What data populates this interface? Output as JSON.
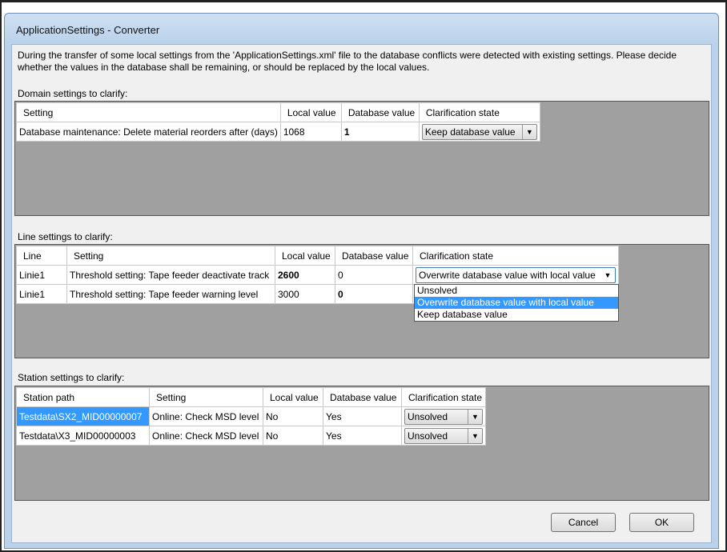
{
  "window": {
    "title": "ApplicationSettings - Converter"
  },
  "description": "During the transfer of some local settings from the 'ApplicationSettings.xml' file to the database conflicts were detected with existing settings. Please decide whether the values in the database shall be remaining, or should be replaced by the local values.",
  "domain": {
    "label": "Domain settings to clarify:",
    "headers": [
      "Setting",
      "Local value",
      "Database value",
      "Clarification state"
    ],
    "rows": [
      {
        "setting": "Database maintenance: Delete material reorders after (days)",
        "local": "1068",
        "database": "1",
        "state": "Keep database value"
      }
    ]
  },
  "line": {
    "label": "Line settings to clarify:",
    "headers": [
      "Line",
      "Setting",
      "Local value",
      "Database value",
      "Clarification state"
    ],
    "rows": [
      {
        "line": "Linie1",
        "setting": "Threshold setting: Tape feeder deactivate track",
        "local": "2600",
        "database": "0",
        "state": "Overwrite database value with local value"
      },
      {
        "line": "Linie1",
        "setting": "Threshold setting: Tape feeder warning level",
        "local": "3000",
        "database": "0",
        "state": ""
      }
    ],
    "dropdown_options": [
      "Unsolved",
      "Overwrite database value with local value",
      "Keep database value"
    ]
  },
  "station": {
    "label": "Station settings to clarify:",
    "headers": [
      "Station path",
      "Setting",
      "Local value",
      "Database value",
      "Clarification state"
    ],
    "rows": [
      {
        "path": "Testdata\\SX2_MID00000007",
        "setting": "Online: Check MSD level",
        "local": "No",
        "database": "Yes",
        "state": "Unsolved"
      },
      {
        "path": "Testdata\\X3_MID00000003",
        "setting": "Online: Check MSD level",
        "local": "No",
        "database": "Yes",
        "state": "Unsolved"
      }
    ]
  },
  "buttons": {
    "cancel": "Cancel",
    "ok": "OK"
  }
}
